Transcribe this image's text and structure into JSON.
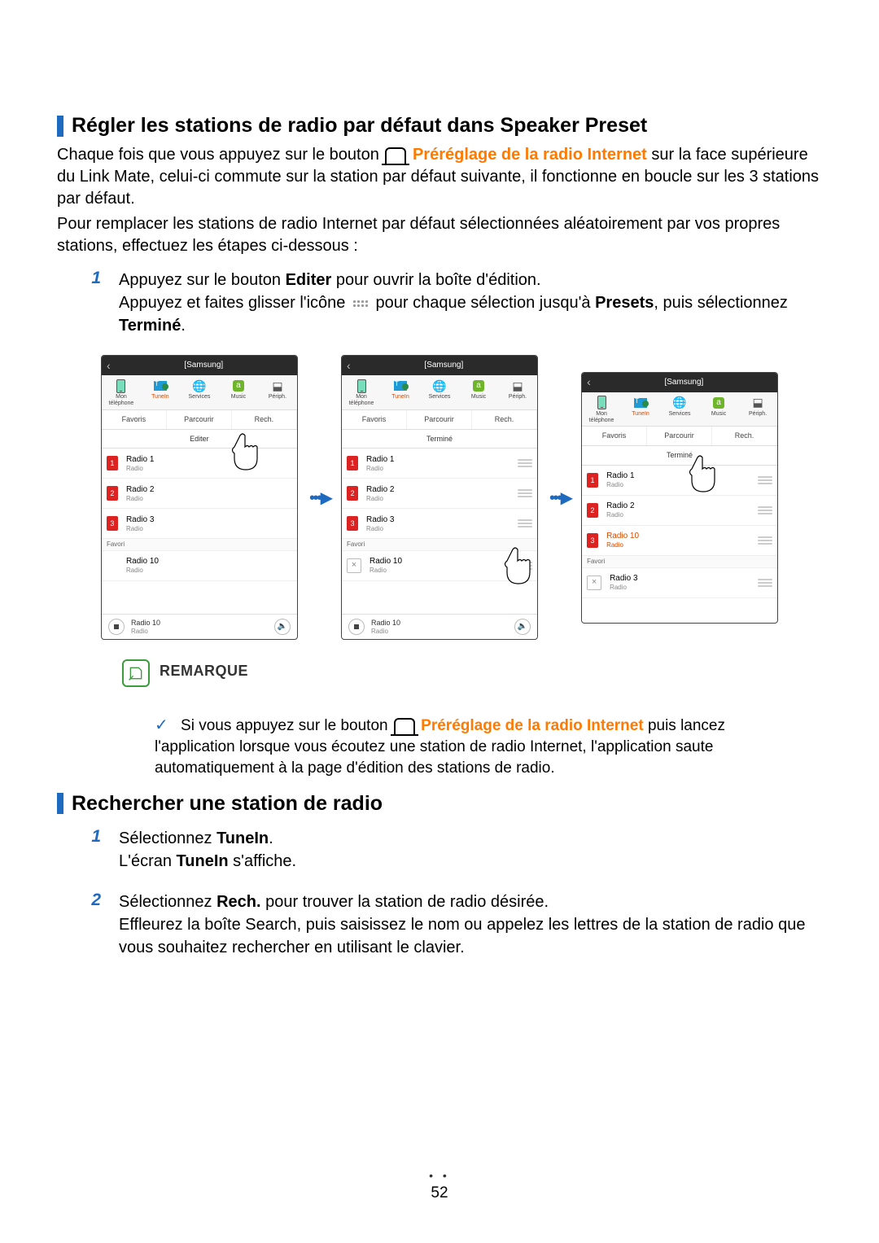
{
  "section1": {
    "title": "Régler les stations de radio par défaut dans Speaker Preset",
    "intro_part1": "Chaque fois que vous appuyez sur le bouton ",
    "preset_link": "Préréglage de la radio Internet",
    "intro_part2": " sur la face supérieure du Link Mate, celui-ci commute sur la station par défaut suivante, il fonctionne en boucle sur les 3 stations par défaut.",
    "intro_replace": "Pour remplacer les stations de radio Internet par défaut sélectionnées aléatoirement par vos propres stations, effectuez les étapes ci-dessous :",
    "step1_num": "1",
    "step1_line1a": "Appuyez sur le bouton ",
    "step1_line1b": "Editer",
    "step1_line1c": " pour ouvrir la boîte d'édition.",
    "step1_line2a": "Appuyez et faites glisser l'icône ",
    "step1_line2b": " pour chaque sélection jusqu'à ",
    "step1_line2c": "Presets",
    "step1_line2d": ", puis sélectionnez ",
    "step1_line2e": "Terminé",
    "step1_line2f": "."
  },
  "phone_common": {
    "header": "[Samsung]",
    "nav": {
      "phone": "Mon téléphone",
      "tunein": "TuneIn",
      "services": "Services",
      "music": "Music",
      "periph": "Périph."
    },
    "subtabs": {
      "favoris": "Favoris",
      "parcourir": "Parcourir",
      "rech": "Rech."
    },
    "action_editer": "Editer",
    "action_termine": "Terminé",
    "section_favori": "Favori",
    "row_sub": "Radio",
    "player_title": "Radio 10",
    "player_sub": "Radio"
  },
  "shot1_rows": [
    "Radio 1",
    "Radio 2",
    "Radio 3",
    "Radio 10"
  ],
  "shot2_rows": [
    "Radio 1",
    "Radio 2",
    "Radio 3",
    "Radio 10"
  ],
  "shot3_presets": [
    "Radio 1",
    "Radio 2",
    "Radio 10"
  ],
  "shot3_favori": [
    "Radio 3"
  ],
  "remark": {
    "title": "REMARQUE",
    "body_a": "Si vous appuyez sur le bouton ",
    "body_link": "Préréglage de la radio Internet",
    "body_b": " puis lancez l'application lorsque vous écoutez une station de radio Internet, l'application saute automatiquement à la page d'édition des stations de radio."
  },
  "section2": {
    "title": "Rechercher une station de radio",
    "step1_num": "1",
    "step1_a": "Sélectionnez ",
    "step1_b": "TuneIn",
    "step1_c": ".",
    "step1_d": "L'écran ",
    "step1_e": "TuneIn",
    "step1_f": " s'affiche.",
    "step2_num": "2",
    "step2_a": "Sélectionnez ",
    "step2_b": "Rech.",
    "step2_c": " pour trouver la station de radio désirée.",
    "step2_d": "Effleurez la boîte Search, puis saisissez le nom ou appelez les lettres de la station de radio que vous souhaitez rechercher en utilisant le clavier."
  },
  "page_number": "52"
}
